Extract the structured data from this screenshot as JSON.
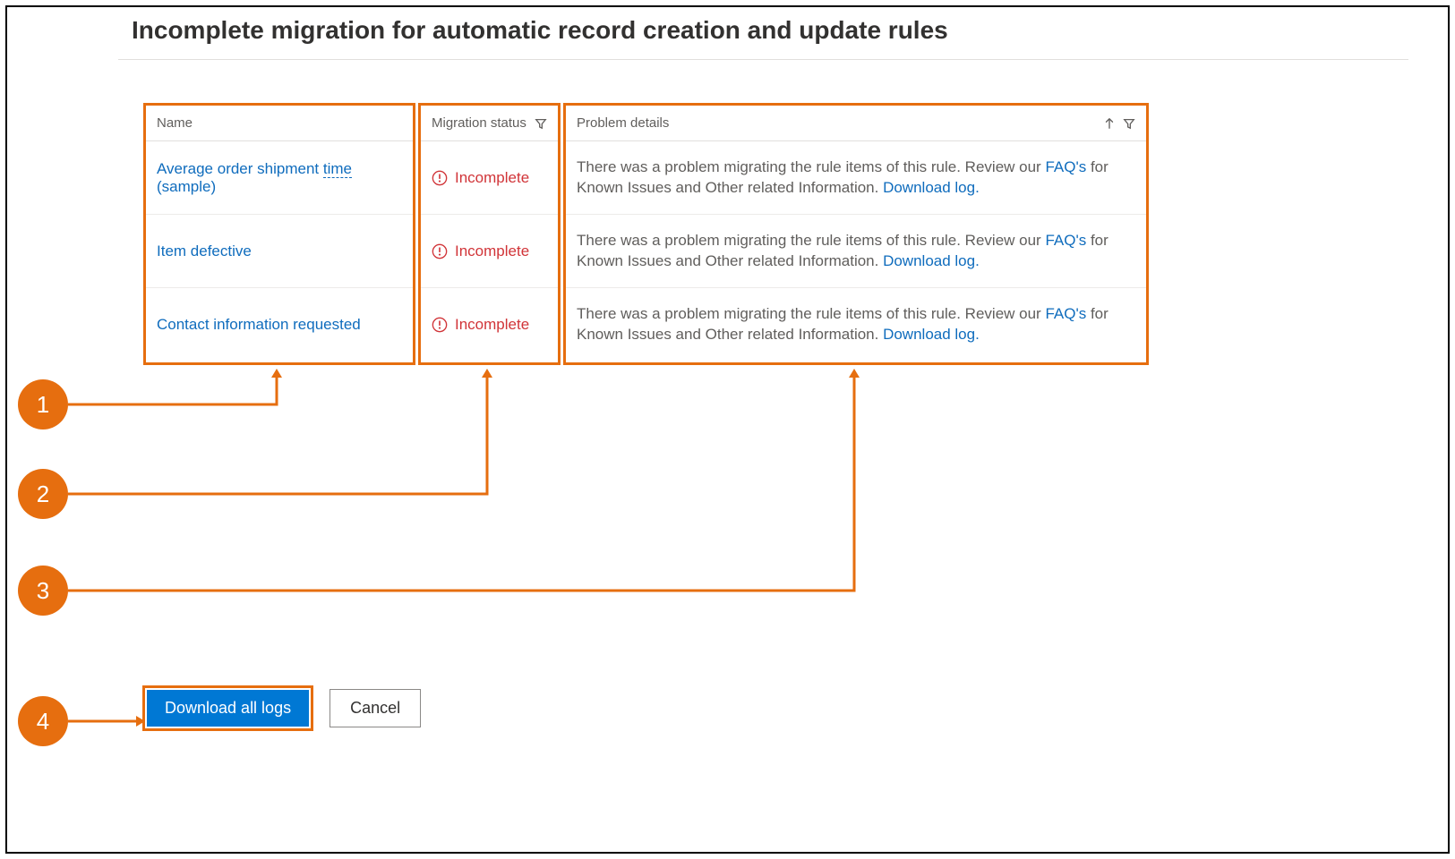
{
  "title": "Incomplete migration for automatic record creation and update rules",
  "columns": {
    "name": "Name",
    "status": "Migration status",
    "details": "Problem details"
  },
  "rows": [
    {
      "name": "Average order shipment ",
      "name_dotted": "time",
      "name_suffix": " (sample)",
      "status": "Incomplete",
      "detail_pre": "There was a problem migrating the rule items of this rule. Review our ",
      "faq": "FAQ's",
      "detail_mid": " for Known Issues and Other related Information. ",
      "dl": "Download log."
    },
    {
      "name": "Item defective",
      "name_dotted": "",
      "name_suffix": "",
      "status": "Incomplete",
      "detail_pre": "There was a problem migrating the rule items of this rule. Review our ",
      "faq": "FAQ's",
      "detail_mid": " for Known Issues and Other related Information. ",
      "dl": "Download log."
    },
    {
      "name": "Contact information requested",
      "name_dotted": "",
      "name_suffix": "",
      "status": "Incomplete",
      "detail_pre": "There was a problem migrating the rule items of this rule. Review our ",
      "faq": "FAQ's",
      "detail_mid": " for Known Issues and Other related Information. ",
      "dl": "Download log."
    }
  ],
  "callouts": [
    "1",
    "2",
    "3",
    "4"
  ],
  "buttons": {
    "primary": "Download all logs",
    "secondary": "Cancel"
  }
}
